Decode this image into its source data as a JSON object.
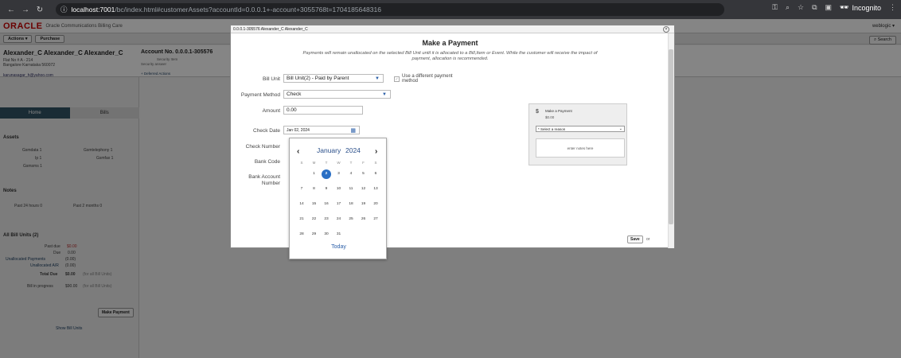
{
  "browser": {
    "url_host": "localhost:7001",
    "url_path": "/bc/index.html#customerAssets?accountId=0.0.0.1+-account+3055768t=1704185648316",
    "incognito_label": "Incognito"
  },
  "app": {
    "brand": "ORACLE",
    "brand_sub": "Oracle Communications Billing Care",
    "user": "weblogic ▾",
    "actions_label": "Actions ▾",
    "purchase_label": "Purchase",
    "search_label": "Search"
  },
  "customer": {
    "name": "Alexander_C Alexander_C Alexander_C",
    "address1": "Flat No # A - 214",
    "address2": "Bangalore Karnataka 560072",
    "email": "karunasagar_h@yahoo.com",
    "account_no": "Account No. 0.0.0.1-305576",
    "acct_sub1": "Security Item",
    "acct_sub2": "Security answer",
    "deferred": "+ Deferred Actions"
  },
  "left": {
    "tab_home": "Home",
    "tab_bills": "Bills",
    "assets_title": "Assets",
    "assets": [
      "Gsmdata 1",
      "Gsmtelephony 1",
      "Ip 1",
      "Gsmfax 1",
      "Gsmsms 1"
    ],
    "notes_title": "Notes",
    "notes": [
      "Past 24 hours 0",
      "Past 2 months 0"
    ],
    "bill_units_title": "All Bill Units (2)",
    "rows": [
      {
        "label": "Past due",
        "value": "$0.00",
        "extra": ""
      },
      {
        "label": "Due",
        "value": "0.00",
        "extra": ""
      },
      {
        "label": "Unallocated Payments",
        "value": "(0.00)",
        "extra": ""
      },
      {
        "label": "Unallocated A/R",
        "value": "(0.00)",
        "extra": ""
      },
      {
        "label": "Total Due",
        "value": "$0.00",
        "extra": "(for all Bill Units)"
      },
      {
        "label": "Bill in progress",
        "value": "$90.00",
        "extra": "(for all Bill Units)"
      }
    ],
    "make_payment": "Make Payment",
    "show_bill_units": "Show Bill Units"
  },
  "dialog": {
    "title": "0.0.0.1-305576 Alexander_C Alexander_C",
    "heading": "Make a Payment",
    "description": "Payments will remain unallocated on the selected Bill Unit until it is allocated to a Bill,Item or Event. While the customer will receive the impact of payment, allocation is recommended.",
    "bill_unit_label": "Bill Unit",
    "bill_unit_value": "Bill Unit(2) - Paid by Parent",
    "use_different_label": "Use a different payment method",
    "payment_method_label": "Payment Method",
    "payment_method_value": "Check",
    "amount_label": "Amount",
    "amount_value": "0.00",
    "check_date_label": "Check Date",
    "check_date_value": "Jan 02, 2024",
    "check_number_label": "Check Number",
    "bank_code_label": "Bank Code",
    "bank_account_label": "Bank Account Number",
    "summary_title": "Make a Payment",
    "summary_amount": "$0.00",
    "reason_placeholder": "* Select a reason",
    "notes_placeholder": "enter notes here",
    "save_label": "Save",
    "or_label": "or"
  },
  "calendar": {
    "month": "January",
    "year": "2024",
    "weekdays": [
      "S",
      "M",
      "T",
      "W",
      "T",
      "F",
      "S"
    ],
    "selected_day": "2",
    "today_label": "Today",
    "weeks": [
      [
        "",
        "1",
        "2",
        "3",
        "4",
        "5",
        "6"
      ],
      [
        "7",
        "8",
        "9",
        "10",
        "11",
        "12",
        "13"
      ],
      [
        "14",
        "15",
        "16",
        "17",
        "18",
        "19",
        "20"
      ],
      [
        "21",
        "22",
        "23",
        "24",
        "25",
        "26",
        "27"
      ],
      [
        "28",
        "29",
        "30",
        "31",
        "",
        "",
        ""
      ]
    ]
  }
}
